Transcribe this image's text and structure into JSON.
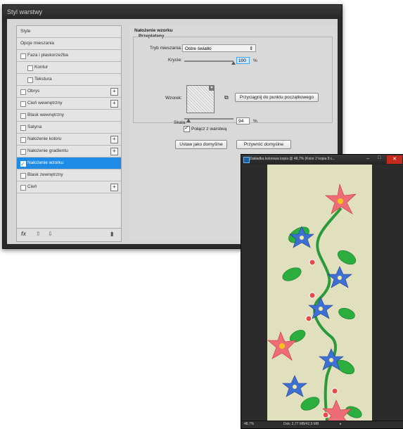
{
  "dialog": {
    "title": "Styl warstwy",
    "styles_list": [
      {
        "label": "Style",
        "checkbox": false,
        "indent": false,
        "plus": false,
        "selected": false
      },
      {
        "label": "Opcje mieszania",
        "checkbox": false,
        "indent": false,
        "plus": false,
        "selected": false
      },
      {
        "label": "Faza i płaskorzeźba",
        "checkbox": true,
        "indent": false,
        "plus": false,
        "selected": false
      },
      {
        "label": "Kontur",
        "checkbox": true,
        "indent": true,
        "plus": false,
        "selected": false
      },
      {
        "label": "Tekstura",
        "checkbox": true,
        "indent": true,
        "plus": false,
        "selected": false
      },
      {
        "label": "Obrys",
        "checkbox": true,
        "indent": false,
        "plus": true,
        "selected": false
      },
      {
        "label": "Cień wewnętrzny",
        "checkbox": true,
        "indent": false,
        "plus": true,
        "selected": false
      },
      {
        "label": "Blask wewnętrzny",
        "checkbox": true,
        "indent": false,
        "plus": false,
        "selected": false
      },
      {
        "label": "Satyna",
        "checkbox": true,
        "indent": false,
        "plus": false,
        "selected": false
      },
      {
        "label": "Nałożenie koloru",
        "checkbox": true,
        "indent": false,
        "plus": true,
        "selected": false
      },
      {
        "label": "Nałożenie gradientu",
        "checkbox": true,
        "indent": false,
        "plus": true,
        "selected": false
      },
      {
        "label": "Nałożenie wzorku",
        "checkbox": true,
        "indent": false,
        "plus": false,
        "selected": true
      },
      {
        "label": "Blask zewnętrzny",
        "checkbox": true,
        "indent": false,
        "plus": false,
        "selected": false
      },
      {
        "label": "Cień",
        "checkbox": true,
        "indent": false,
        "plus": true,
        "selected": false
      }
    ],
    "footer": {
      "fx": "fx",
      "trash_icon": "trash-icon",
      "up_icon": "arrow-up-icon",
      "down_icon": "arrow-down-icon"
    },
    "panel": {
      "section_title": "Nałożenie wzorku",
      "group_title": "Przeplatany",
      "blend_mode_label": "Tryb mieszania:",
      "blend_mode_value": "Ostre światło",
      "opacity_label": "Krycie:",
      "opacity_value": "100",
      "opacity_unit": "%",
      "opacity_fraction": 1.0,
      "pattern_label": "Wzorek:",
      "snap_button": "Przyciągnij do punktu początkowego",
      "scale_label": "Skala:",
      "scale_value": "94",
      "scale_unit": "%",
      "scale_fraction": 0.09,
      "link_label": "Połącz z warstwą",
      "link_checked": true,
      "make_default_button": "Ustaw jako domyślne",
      "reset_default_button": "Przywróć domyślne"
    },
    "accent": "#1e8be6"
  },
  "document": {
    "title": "Zakładka kolorowa kopia @ 48,7% (Kolor 2 kopia 8 c...",
    "zoom": "48,7%",
    "doc_info": "Dok: 2,77 MB/42,9 MB",
    "canvas_color": "#e4e4c2"
  }
}
